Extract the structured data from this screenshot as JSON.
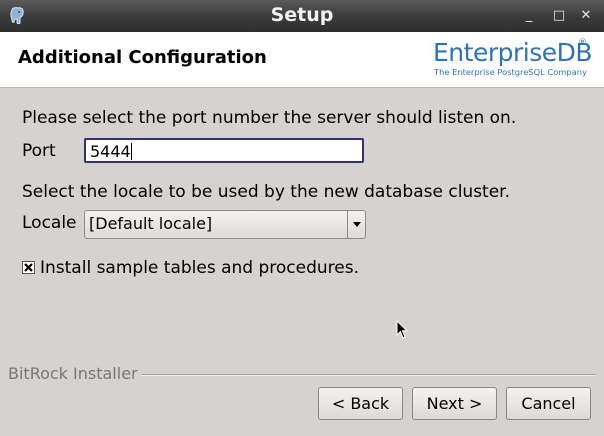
{
  "window": {
    "title": "Setup",
    "minimize_glyph": "_",
    "maximize_glyph": "□",
    "close_glyph": "✕"
  },
  "header": {
    "heading": "Additional Configuration",
    "logo": {
      "brand_main": "Enterprise",
      "brand_suffix": "DB",
      "registered": "®",
      "tagline": "The Enterprise PostgreSQL Company"
    }
  },
  "port_section": {
    "instruction": "Please select the port number the server should listen on.",
    "label": "Port",
    "value": "5444"
  },
  "locale_section": {
    "instruction": "Select the locale to be used by the new database cluster.",
    "label": "Locale",
    "selected": "[Default locale]"
  },
  "sample_tables": {
    "label": "Install sample tables and procedures.",
    "checked": true
  },
  "footer": {
    "installer_label": "BitRock Installer",
    "back_label": "< Back",
    "next_label": "Next >",
    "cancel_label": "Cancel"
  },
  "colors": {
    "titlebar": "#3a3a3a",
    "dialog_bg": "#d6d2d0",
    "brand_blue": "#2e73b8",
    "input_focus": "#32327a"
  }
}
